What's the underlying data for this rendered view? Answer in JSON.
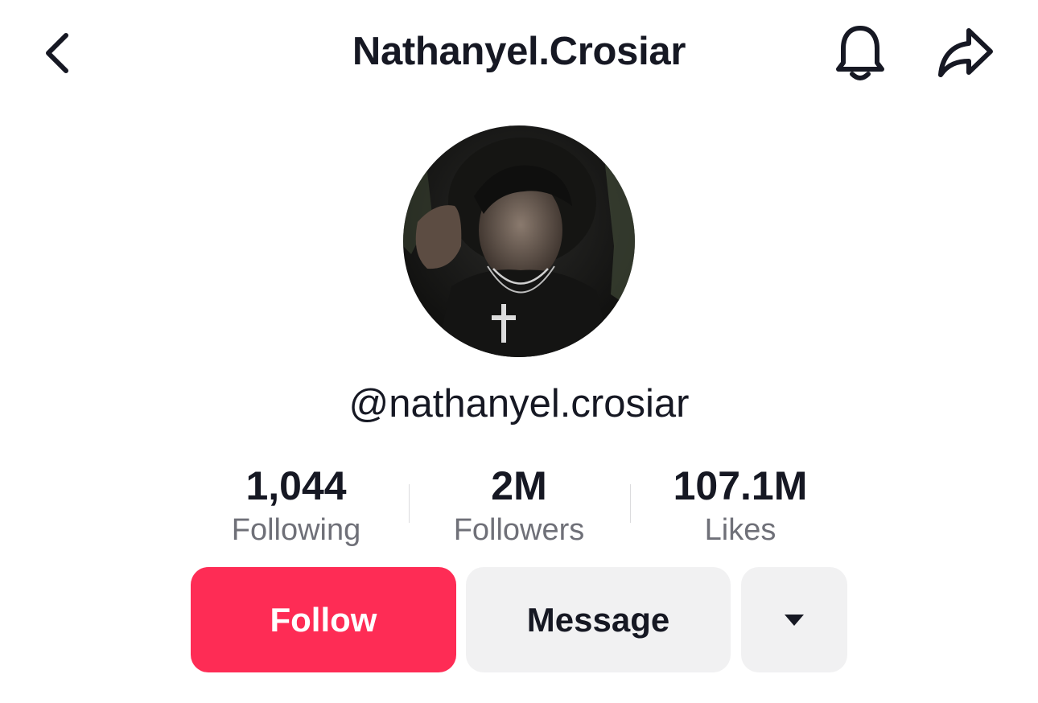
{
  "header": {
    "title": "Nathanyel.Crosiar",
    "back_icon": "chevron-left-icon",
    "notification_icon": "bell-icon",
    "share_icon": "share-arrow-icon"
  },
  "profile": {
    "avatar_icon": "profile-photo",
    "handle": "@nathanyel.crosiar"
  },
  "stats": {
    "following": {
      "value": "1,044",
      "label": "Following"
    },
    "followers": {
      "value": "2M",
      "label": "Followers"
    },
    "likes": {
      "value": "107.1M",
      "label": "Likes"
    }
  },
  "actions": {
    "follow_label": "Follow",
    "message_label": "Message",
    "more_icon": "caret-down-icon"
  },
  "colors": {
    "accent": "#fe2c55",
    "secondary_button_bg": "#f1f1f2",
    "text_primary": "#161823",
    "text_secondary": "#6f7078"
  }
}
